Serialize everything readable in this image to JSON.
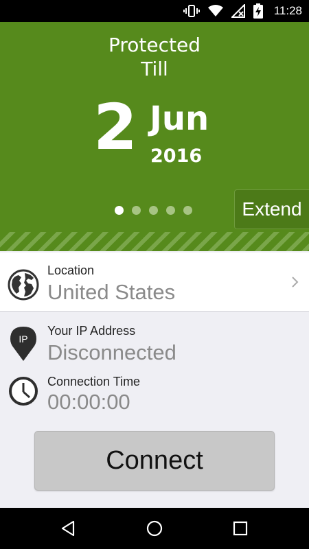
{
  "status_bar": {
    "time": "11:28",
    "icons": [
      "vibrate-icon",
      "wifi-icon",
      "no-signal-icon",
      "battery-charging-icon"
    ]
  },
  "header": {
    "title_line1": "Protected",
    "title_line2": "Till",
    "day": "2",
    "month": "Jun",
    "year": "2016",
    "page_indicator": {
      "count": 5,
      "active_index": 0
    },
    "extend_label": "Extend",
    "colors": {
      "background": "#568a1c",
      "stripe": "#7aa64a"
    }
  },
  "location": {
    "label": "Location",
    "value": "United States",
    "icon": "globe-icon"
  },
  "ip": {
    "label": "Your IP Address",
    "value": "Disconnected",
    "icon_text": "IP",
    "icon": "ip-pin-icon"
  },
  "connection_time": {
    "label": "Connection Time",
    "value": "00:00:00",
    "icon": "clock-icon"
  },
  "connect_label": "Connect",
  "nav": {
    "icons": [
      "back-icon",
      "home-icon",
      "recents-icon"
    ]
  }
}
